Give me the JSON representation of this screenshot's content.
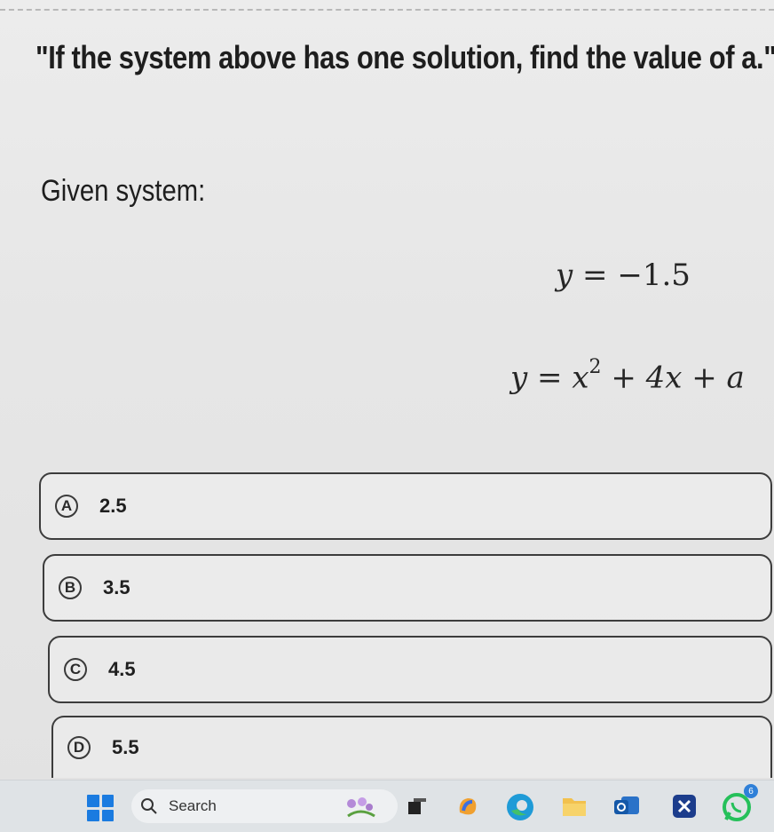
{
  "question": "\"If the system above has one solution, find the value of a.\"",
  "given_label": "Given system:",
  "equations": {
    "eq1": {
      "lhs": "y",
      "rel": "=",
      "rhs": "−1.5"
    },
    "eq2": {
      "lhs": "y",
      "rel": "=",
      "var": "x",
      "exp": "2",
      "rest": "+ 4x + a"
    }
  },
  "options": [
    {
      "letter": "A",
      "value": "2.5"
    },
    {
      "letter": "B",
      "value": "3.5"
    },
    {
      "letter": "C",
      "value": "4.5"
    },
    {
      "letter": "D",
      "value": "5.5"
    }
  ],
  "taskbar": {
    "search_placeholder": "Search",
    "notification_count": "6",
    "icons": [
      "windows-start-icon",
      "search-icon",
      "widgets-flower-icon",
      "taskview-icon",
      "copilot-icon",
      "edge-icon",
      "file-explorer-icon",
      "outlook-icon",
      "snipping-tool-icon",
      "whatsapp-icon"
    ],
    "colors": {
      "windows": "#1a7be0",
      "edge": "#1f9bd7",
      "folder": "#f2c14e",
      "whatsapp": "#25c05a",
      "copilot": "#f0a030"
    }
  }
}
